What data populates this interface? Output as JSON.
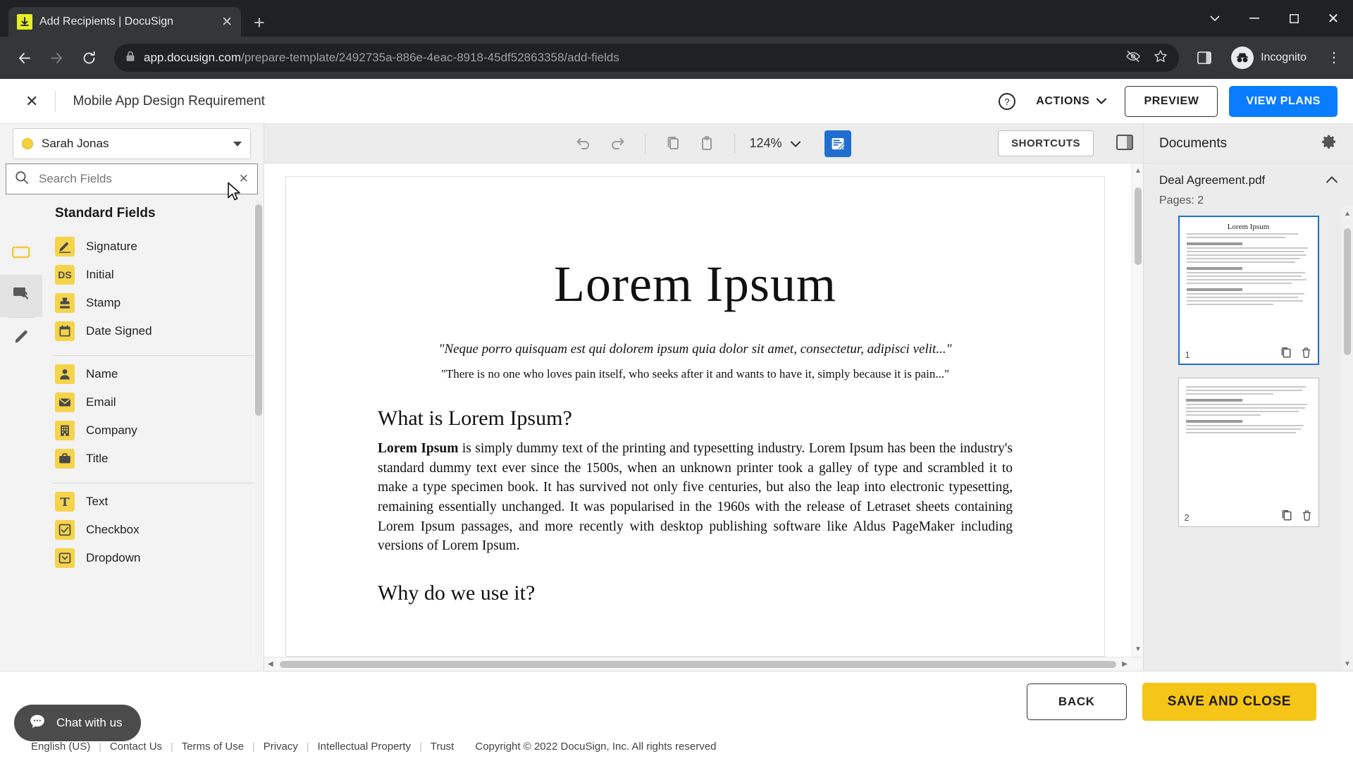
{
  "browser": {
    "tab": {
      "title": "Add Recipients | DocuSign",
      "favicon_icon": "download-icon",
      "close_icon": "close-icon"
    },
    "new_tab_label": "+",
    "window": {
      "minimize": "–",
      "maximize": "□",
      "close": "✕",
      "chevron": "⌄"
    },
    "nav": {
      "back_icon": "arrow-left-icon",
      "forward_icon": "arrow-right-icon",
      "reload_icon": "reload-icon"
    },
    "omnibox": {
      "lock_icon": "lock-icon",
      "url_domain": "app.docusign.com",
      "url_path": "/prepare-template/2492735a-886e-4eac-8918-45df52863358/add-fields",
      "eye_icon": "eye-off-icon",
      "bookmark_icon": "star-icon"
    },
    "side_panel_icon": "side-panel-icon",
    "incognito_label": "Incognito",
    "menu_icon": "kebab-menu-icon"
  },
  "header": {
    "close_icon": "close-icon",
    "title": "Mobile App Design Requirement",
    "help_icon": "help-circle-icon",
    "actions_label": "ACTIONS",
    "actions_caret": "chevron-down-icon",
    "preview_label": "PREVIEW",
    "view_plans_label": "VIEW PLANS",
    "view_plans_color": "#0a7cff"
  },
  "left_panel": {
    "recipient": {
      "name": "Sarah Jonas",
      "dot_color": "#f3d03e"
    },
    "search": {
      "placeholder": "Search Fields",
      "value": "",
      "search_icon": "search-icon",
      "clear_icon": "close-icon"
    },
    "rail": [
      {
        "name": "fields-tool",
        "icon": "field-rect-icon",
        "active": false
      },
      {
        "name": "settings-tool",
        "icon": "wrench-screen-icon",
        "active": true
      },
      {
        "name": "annotate-tool",
        "icon": "pencil-icon",
        "active": false
      }
    ],
    "section_title": "Standard Fields",
    "groups": [
      {
        "items": [
          {
            "label": "Signature",
            "icon": "signature-icon"
          },
          {
            "label": "Initial",
            "icon": "initial-ds-icon"
          },
          {
            "label": "Stamp",
            "icon": "stamp-icon"
          },
          {
            "label": "Date Signed",
            "icon": "calendar-icon"
          }
        ]
      },
      {
        "items": [
          {
            "label": "Name",
            "icon": "person-icon"
          },
          {
            "label": "Email",
            "icon": "envelope-icon"
          },
          {
            "label": "Company",
            "icon": "building-icon"
          },
          {
            "label": "Title",
            "icon": "briefcase-icon"
          }
        ]
      },
      {
        "items": [
          {
            "label": "Text",
            "icon": "text-t-icon"
          },
          {
            "label": "Checkbox",
            "icon": "checkbox-icon"
          },
          {
            "label": "Dropdown",
            "icon": "dropdown-icon"
          }
        ]
      }
    ]
  },
  "toolbar": {
    "undo_icon": "undo-icon",
    "redo_icon": "redo-icon",
    "copy_icon": "copy-icon",
    "paste_icon": "paste-icon",
    "zoom_level": "124%",
    "zoom_caret": "chevron-down-icon",
    "field_view_icon": "field-view-icon",
    "shortcuts_label": "SHORTCUTS",
    "panel_toggle_icon": "panel-toggle-icon"
  },
  "document": {
    "title": "Lorem Ipsum",
    "quote1": "\"Neque porro quisquam est qui dolorem ipsum quia dolor sit amet, consectetur, adipisci velit...\"",
    "quote2": "\"There is no one who loves pain itself, who seeks after it and wants to have it, simply because it is pain...\"",
    "heading1": "What is Lorem Ipsum?",
    "paragraph1_bold": "Lorem Ipsum",
    "paragraph1": " is simply dummy text of the printing and typesetting industry. Lorem Ipsum has been the industry's standard dummy text ever since the 1500s, when an unknown printer took a galley of type and scrambled it to make a type specimen book. It has survived not only five centuries, but also the leap into electronic typesetting, remaining essentially unchanged. It was popularised in the 1960s with the release of Letraset sheets containing Lorem Ipsum passages, and more recently with desktop publishing software like Aldus PageMaker including versions of Lorem Ipsum.",
    "heading2": "Why do we use it?"
  },
  "right_panel": {
    "title": "Documents",
    "settings_icon": "gear-icon",
    "file_name": "Deal Agreement.pdf",
    "collapse_icon": "chevron-up-icon",
    "pages_label": "Pages: 2",
    "thumbnails": [
      {
        "page": "1",
        "title": "Lorem Ipsum",
        "selected": true,
        "duplicate_icon": "duplicate-icon",
        "delete_icon": "trash-icon"
      },
      {
        "page": "2",
        "title": "",
        "selected": false,
        "duplicate_icon": "duplicate-icon",
        "delete_icon": "trash-icon"
      }
    ]
  },
  "footer": {
    "back_label": "BACK",
    "save_label": "SAVE AND CLOSE",
    "save_color": "#f5c518",
    "chat_label": "Chat with us",
    "chat_icon": "chat-icon",
    "legal": {
      "language": "English (US)",
      "links": [
        "Contact Us",
        "Terms of Use",
        "Privacy",
        "Intellectual Property",
        "Trust"
      ],
      "copyright": "Copyright © 2022 DocuSign, Inc. All rights reserved"
    }
  }
}
